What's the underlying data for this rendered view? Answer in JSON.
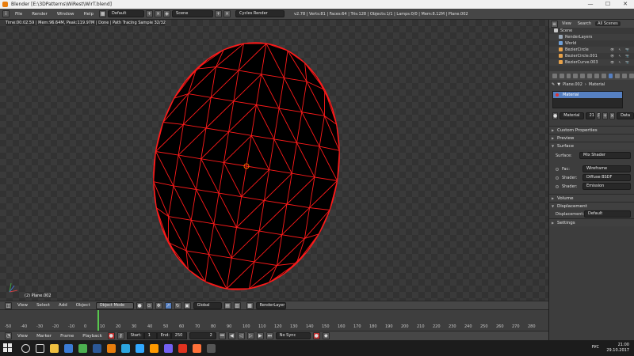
{
  "window": {
    "title": "Blender [E:\\3DPatterns\\WiRest\\WirT.blend]",
    "buttons": [
      "—",
      "☐",
      "✕"
    ]
  },
  "infobar": {
    "menus": [
      "File",
      "Render",
      "Window",
      "Help"
    ],
    "layout": "Default",
    "scene": "Scene",
    "engine": "Cycles Render",
    "stats": "v2.78 | Verts:81 | Faces:64 | Tris:128 | Objects:1/1 | Lamps:0/0 | Mem:8.12M | Plane.002"
  },
  "viewport": {
    "status": "Time:00:02.59 | Mem:96.64M, Peak:119.97M | Done | Path Tracing Sample 32/32",
    "object_label": "(2) Plane.002",
    "colors": {
      "background": "#393939",
      "mesh_fill": "#000000",
      "wire": "#ff1a1a"
    }
  },
  "viewport_header": {
    "menus": [
      "View",
      "Select",
      "Add",
      "Object"
    ],
    "mode": "Object Mode",
    "pivot": "Global",
    "render_layer": "RenderLayer"
  },
  "timeline": {
    "ticks": [
      "-50",
      "-40",
      "-30",
      "-20",
      "-10",
      "0",
      "10",
      "20",
      "30",
      "40",
      "50",
      "60",
      "70",
      "80",
      "90",
      "100",
      "110",
      "120",
      "130",
      "140",
      "150",
      "160",
      "170",
      "180",
      "190",
      "200",
      "210",
      "220",
      "230",
      "240",
      "250",
      "260",
      "270",
      "280"
    ],
    "current_frame": "2"
  },
  "timeline_header": {
    "menus": [
      "View",
      "Marker",
      "Frame",
      "Playback"
    ],
    "start": "Start:",
    "start_value": "1",
    "end": "End:",
    "end_value": "250",
    "frame": "2",
    "sync": "No Sync"
  },
  "outliner": {
    "tabs": [
      "View",
      "Search",
      "All Scenes"
    ],
    "rows": [
      {
        "label": "Scene",
        "icon_color": "#c9c9c9"
      },
      {
        "label": "RenderLayers",
        "icon_color": "#9aa8b8"
      },
      {
        "label": "World",
        "icon_color": "#6fa0d8"
      },
      {
        "label": "BezierCircle",
        "icon_color": "#e8a24a"
      },
      {
        "label": "BezierCircle.001",
        "icon_color": "#e8a24a"
      },
      {
        "label": "BezierCurve.003",
        "icon_color": "#e8a24a"
      }
    ]
  },
  "properties": {
    "crumbs": [
      "Plane.002",
      "Material"
    ],
    "material_slot": "Material",
    "material_name": "Material",
    "users": "21",
    "data": "Data",
    "panels": {
      "custom": "Custom Properties",
      "preview": "Preview",
      "surface": "Surface",
      "volume": "Volume",
      "displacement": "Displacement",
      "settings": "Settings"
    },
    "surface_label": "Surface:",
    "surface_value": "Mix Shader",
    "fac_label": "Fac:",
    "fac_value": "Wireframe",
    "shader1_label": "Shader:",
    "shader1_value": "Diffuse BSDF",
    "shader2_label": "Shader:",
    "shader2_value": "Emission",
    "disp_label": "Displacement:",
    "disp_value": "Default"
  },
  "taskbar": {
    "apps": [
      {
        "name": "search-icon",
        "color": "#dddddd"
      },
      {
        "name": "task-view-icon",
        "color": "#dddddd"
      },
      {
        "name": "explorer-icon",
        "color": "#f0c040"
      },
      {
        "name": "store-icon",
        "color": "#3a7bd5"
      },
      {
        "name": "chrome-icon",
        "color": "#4caf50"
      },
      {
        "name": "word-icon",
        "color": "#2b5797"
      },
      {
        "name": "blender-icon",
        "color": "#e87d0d"
      },
      {
        "name": "telegram-icon",
        "color": "#2ca5e0"
      },
      {
        "name": "photoshop-icon",
        "color": "#31a8ff"
      },
      {
        "name": "illustrator-icon",
        "color": "#ff9a00"
      },
      {
        "name": "viber-icon",
        "color": "#7360f2"
      },
      {
        "name": "acrobat-icon",
        "color": "#e0321f"
      },
      {
        "name": "firefox-icon",
        "color": "#ff7139"
      },
      {
        "name": "calculator-icon",
        "color": "#555555"
      }
    ],
    "lang": "РУС",
    "time": "21:00",
    "date": "29.10.2017"
  }
}
